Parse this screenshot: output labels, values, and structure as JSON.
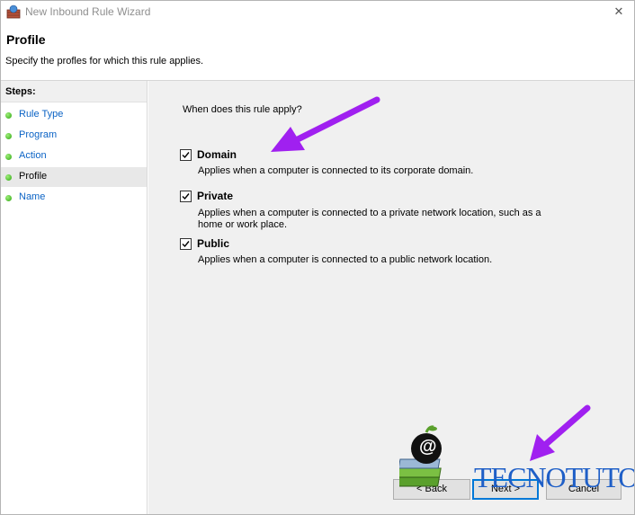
{
  "window": {
    "title": "New Inbound Rule Wizard",
    "close_glyph": "✕"
  },
  "header": {
    "title": "Profile",
    "subtitle": "Specify the profles for which this rule applies."
  },
  "steps": {
    "label": "Steps:",
    "items": [
      {
        "label": "Rule Type",
        "active": false
      },
      {
        "label": "Program",
        "active": false
      },
      {
        "label": "Action",
        "active": false
      },
      {
        "label": "Profile",
        "active": true
      },
      {
        "label": "Name",
        "active": false
      }
    ]
  },
  "main": {
    "question": "When does this rule apply?",
    "options": [
      {
        "label": "Domain",
        "checked": true,
        "description": "Applies when a computer is connected to its corporate domain."
      },
      {
        "label": "Private",
        "checked": true,
        "description": "Applies when a computer is connected to a private network location, such as a home or work place."
      },
      {
        "label": "Public",
        "checked": true,
        "description": "Applies when a computer is connected to a public network location."
      }
    ]
  },
  "buttons": {
    "back": "< Back",
    "next": "Next >",
    "cancel": "Cancel"
  },
  "watermark": {
    "text": "TECNOTUTO",
    "logo_glyph": "@"
  },
  "colors": {
    "annotation_arrow": "#a020f0",
    "link": "#0b63c5",
    "watermark": "#1f5fc7"
  }
}
